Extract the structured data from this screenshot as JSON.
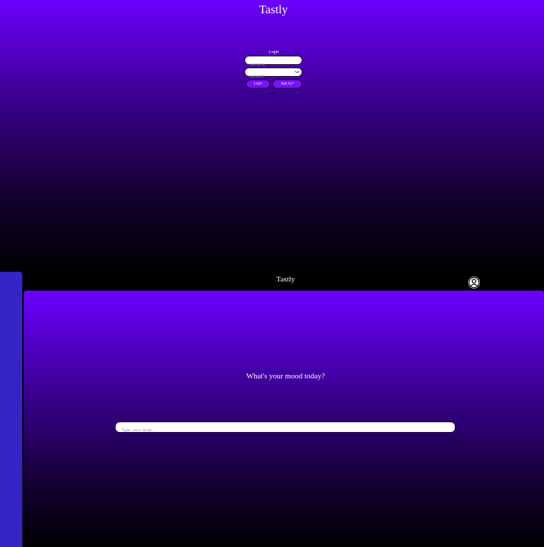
{
  "login_screen": {
    "app_title": "Tastly",
    "form_title": "Login",
    "username_placeholder": "username",
    "password_placeholder": "password",
    "password_toggle_icon": "eye-closed-icon",
    "login_button": "Login",
    "signup_button": "Sign Up?"
  },
  "app_screen": {
    "header_title": "Tastly",
    "profile_icon": "user-circle-icon",
    "mood_question": "What's your mood today?",
    "mood_placeholder": "Type your mood..."
  },
  "colors": {
    "gradient_top": "#6b00ff",
    "gradient_bottom": "#000000",
    "sidebar": "#3624c4",
    "button": "#7b10ff"
  }
}
